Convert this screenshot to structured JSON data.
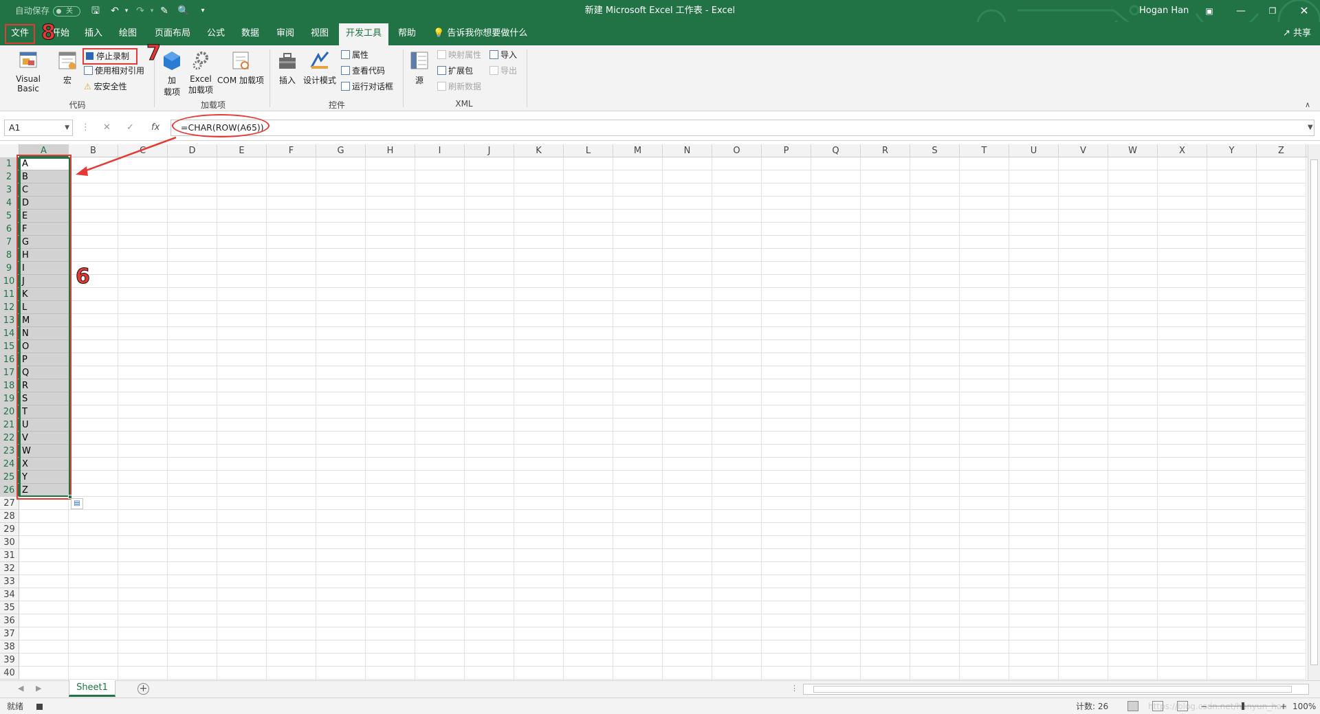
{
  "titlebar": {
    "autosave_label": "自动保存",
    "autosave_state": "关",
    "doc_title": "新建 Microsoft Excel 工作表 - Excel",
    "user": "Hogan Han",
    "theme_color": "#217346"
  },
  "tabs": [
    {
      "label": "文件"
    },
    {
      "label": "开始"
    },
    {
      "label": "插入"
    },
    {
      "label": "绘图"
    },
    {
      "label": "页面布局"
    },
    {
      "label": "公式"
    },
    {
      "label": "数据"
    },
    {
      "label": "审阅"
    },
    {
      "label": "视图"
    },
    {
      "label": "开发工具"
    },
    {
      "label": "帮助"
    }
  ],
  "active_tab": "开发工具",
  "tell_me": "告诉我你想要做什么",
  "share": "共享",
  "ribbon": {
    "code": {
      "visual_basic": "Visual Basic",
      "macros": "宏",
      "stop_recording": "停止录制",
      "relative_ref": "使用相对引用",
      "macro_security": "宏安全性",
      "label": "代码"
    },
    "addins": {
      "addins": "加\n载项",
      "excel_addins": "Excel\n加载项",
      "com_addins": "COM 加载项",
      "label": "加载项"
    },
    "controls": {
      "insert": "插入",
      "design_mode": "设计模式",
      "properties": "属性",
      "view_code": "查看代码",
      "run_dialog": "运行对话框",
      "label": "控件"
    },
    "xml": {
      "source": "源",
      "map_props": "映射属性",
      "expansion": "扩展包",
      "refresh": "刷新数据",
      "import": "导入",
      "export": "导出",
      "label": "XML"
    }
  },
  "formula_bar": {
    "name_box": "A1",
    "fx": "fx",
    "formula": "=CHAR(ROW(A65))"
  },
  "columns": [
    "A",
    "B",
    "C",
    "D",
    "E",
    "F",
    "G",
    "H",
    "I",
    "J",
    "K",
    "L",
    "M",
    "N",
    "O",
    "P",
    "Q",
    "R",
    "S",
    "T",
    "U",
    "V",
    "W",
    "X",
    "Y",
    "Z"
  ],
  "rows": [
    "1",
    "2",
    "3",
    "4",
    "5",
    "6",
    "7",
    "8",
    "9",
    "10",
    "11",
    "12",
    "13",
    "14",
    "15",
    "16",
    "17",
    "18",
    "19",
    "20",
    "21",
    "22",
    "23",
    "24",
    "25",
    "26",
    "27",
    "28",
    "29",
    "30",
    "31",
    "32",
    "33",
    "34",
    "35",
    "36",
    "37",
    "38",
    "39",
    "40"
  ],
  "column_a_values": [
    "A",
    "B",
    "C",
    "D",
    "E",
    "F",
    "G",
    "H",
    "I",
    "J",
    "K",
    "L",
    "M",
    "N",
    "O",
    "P",
    "Q",
    "R",
    "S",
    "T",
    "U",
    "V",
    "W",
    "X",
    "Y",
    "Z"
  ],
  "annotations": {
    "n6": "6",
    "n7": "7",
    "n8": "8",
    "color": "#e53935"
  },
  "sheet_tab": "Sheet1",
  "status": {
    "ready": "就绪",
    "count": "计数: 26",
    "zoom": "100%",
    "watermark": "https://blog.csdn.net/hanyun_han"
  }
}
